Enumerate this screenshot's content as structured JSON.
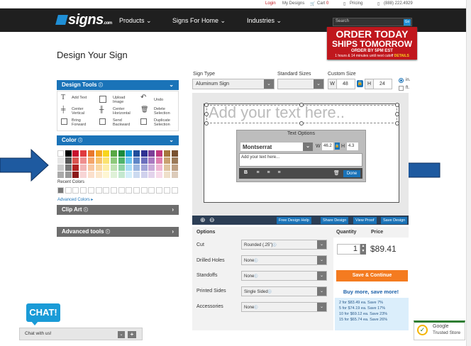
{
  "topbar": {
    "login": "Login",
    "my_designs": "My Designs",
    "cart": "Cart",
    "cart_count": "0",
    "pricing": "Pricing",
    "phone": "(888) 222.4929"
  },
  "nav": {
    "logo": "signs",
    "logo_sub": ".com",
    "items": [
      "Products",
      "Signs For Home",
      "Industries"
    ],
    "search_placeholder": "Search",
    "go": "Go"
  },
  "promo": {
    "line1": "ORDER TODAY",
    "line2": "SHIPS TOMORROW",
    "line3": "ORDER BY 5PM EST",
    "line4": "1 hours & 14 minutes until next cutoff",
    "details": "DETAILS"
  },
  "page_title": "Design Your Sign",
  "design_tools": {
    "header": "Design Tools",
    "tools": [
      {
        "label": "Add Text"
      },
      {
        "label": "Upload Image"
      },
      {
        "label": "Undo"
      },
      {
        "label": "Center Vertical"
      },
      {
        "label": "Center Horizontal"
      },
      {
        "label": "Delete Selection"
      },
      {
        "label": "Bring Forward"
      },
      {
        "label": "Send Backward"
      },
      {
        "label": "Duplicate Selection"
      }
    ]
  },
  "color": {
    "header": "Color",
    "recent_label": "Recent Colors",
    "advanced": "Advanced Colors ▸",
    "rows": [
      [
        "#ffffff",
        "#000000",
        "#c8102e",
        "#e03a3e",
        "#e8772e",
        "#f5a623",
        "#f8d51c",
        "#58a845",
        "#1b8a3c",
        "#1a9bd7",
        "#1f4e9c",
        "#2e3192",
        "#7b3f98",
        "#c2387f",
        "#a6763d",
        "#7a5230"
      ],
      [
        "#e6e6e6",
        "#555555",
        "#d9534f",
        "#ef8e8e",
        "#f4a56b",
        "#f7c26b",
        "#fbe36f",
        "#8dc97b",
        "#4fb36b",
        "#6cc3ec",
        "#5e86c7",
        "#6b6fbd",
        "#a97ac0",
        "#de7fb0",
        "#c9a070",
        "#9c7a58"
      ],
      [
        "#cccccc",
        "#777777",
        "#b22222",
        "#f2b5b5",
        "#f8c7a0",
        "#fad7a0",
        "#fdeea6",
        "#bfe2b3",
        "#8fd3a5",
        "#a9dcf5",
        "#9bb6e0",
        "#a2a5d8",
        "#c9aad8",
        "#efb5d3",
        "#e0c49f",
        "#bfa083"
      ],
      [
        "#aaaaaa",
        "#999999",
        "#8b1a1a",
        "#f8d5d5",
        "#fbe0cc",
        "#fce8cc",
        "#fef6d2",
        "#dff1d8",
        "#c4e8cf",
        "#d3eefa",
        "#cbdaf0",
        "#d0d1ed",
        "#e3d3ec",
        "#f7dae9",
        "#efe0ca",
        "#dccbba"
      ]
    ]
  },
  "clip_art": "Clip Art",
  "advanced_tools": "Advanced tools",
  "sign_type": {
    "label": "Sign Type",
    "value": "Aluminum Sign"
  },
  "standard_sizes": {
    "label": "Standard Sizes",
    "value": ""
  },
  "custom_size": {
    "label": "Custom Size",
    "w_label": "W",
    "w": "48",
    "h_label": "H",
    "h": "24",
    "unit_in": "in.",
    "unit_ft": "ft."
  },
  "canvas": {
    "placeholder": "Add your text here..",
    "text_options": "Text Options",
    "font": "Montserrat",
    "w_label": "W",
    "w": "46.2",
    "h_label": "H",
    "h": "4.3",
    "textarea": "Add your text here...",
    "done": "Done"
  },
  "toolbar": {
    "free_help": "Free Design Help",
    "share": "Share Design",
    "proof": "View Proof",
    "save": "Save Design"
  },
  "options": {
    "header": "Options",
    "rows": [
      {
        "label": "Cut",
        "value": "Rounded (.25\")"
      },
      {
        "label": "Drilled Holes",
        "value": "None"
      },
      {
        "label": "Standoffs",
        "value": "None"
      },
      {
        "label": "Printed Sides",
        "value": "Single Sided"
      },
      {
        "label": "Accessories",
        "value": "None"
      }
    ]
  },
  "quantity": {
    "header": "Quantity",
    "value": "1"
  },
  "price": {
    "header": "Price",
    "value": "$89.41"
  },
  "save_continue": "Save & Continue",
  "buy_more": "Buy more, save more!",
  "bulk": [
    "2 for $83.49 ea. Save 7%",
    "5 for $74.19 ea. Save 17%",
    "10 for $69.12 ea. Save 23%",
    "15 for $65.74 ea. Save 26%"
  ],
  "chat": {
    "badge": "CHAT!",
    "bar": "Chat with us!"
  },
  "trusted": {
    "line1": "Google",
    "line2": "Trusted Store"
  }
}
